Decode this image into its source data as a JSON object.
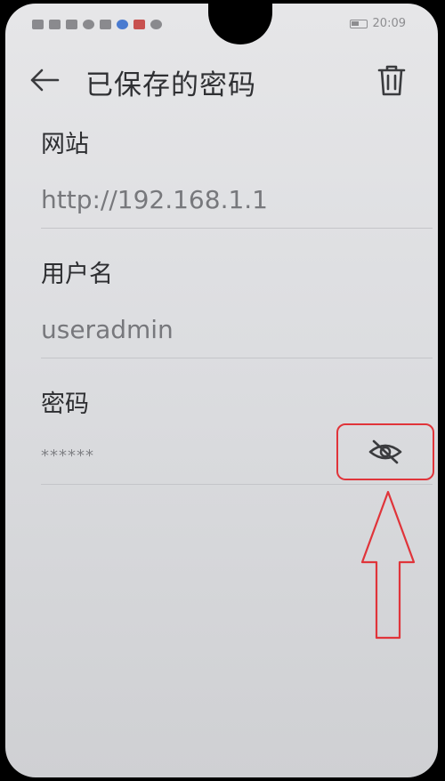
{
  "status_bar": {
    "time": "20:09",
    "icons": [
      "notification-icon",
      "signal-icon",
      "signal-icon",
      "wifi-icon",
      "app-icon",
      "app-icon",
      "app-icon",
      "cloud-icon",
      "battery-icon"
    ]
  },
  "header": {
    "back_icon": "arrow-left-icon",
    "title": "已保存的密码",
    "delete_icon": "trash-icon"
  },
  "fields": {
    "site_label": "网站",
    "site_value": "http://192.168.1.1",
    "username_label": "用户名",
    "username_value": "useradmin",
    "password_label": "密码",
    "password_value": "******",
    "visibility_icon": "eye-off-icon"
  },
  "colors": {
    "background": "#dcdde0",
    "highlight": "#e0343a",
    "text_primary": "#2d2e31",
    "text_secondary": "#77787c"
  }
}
